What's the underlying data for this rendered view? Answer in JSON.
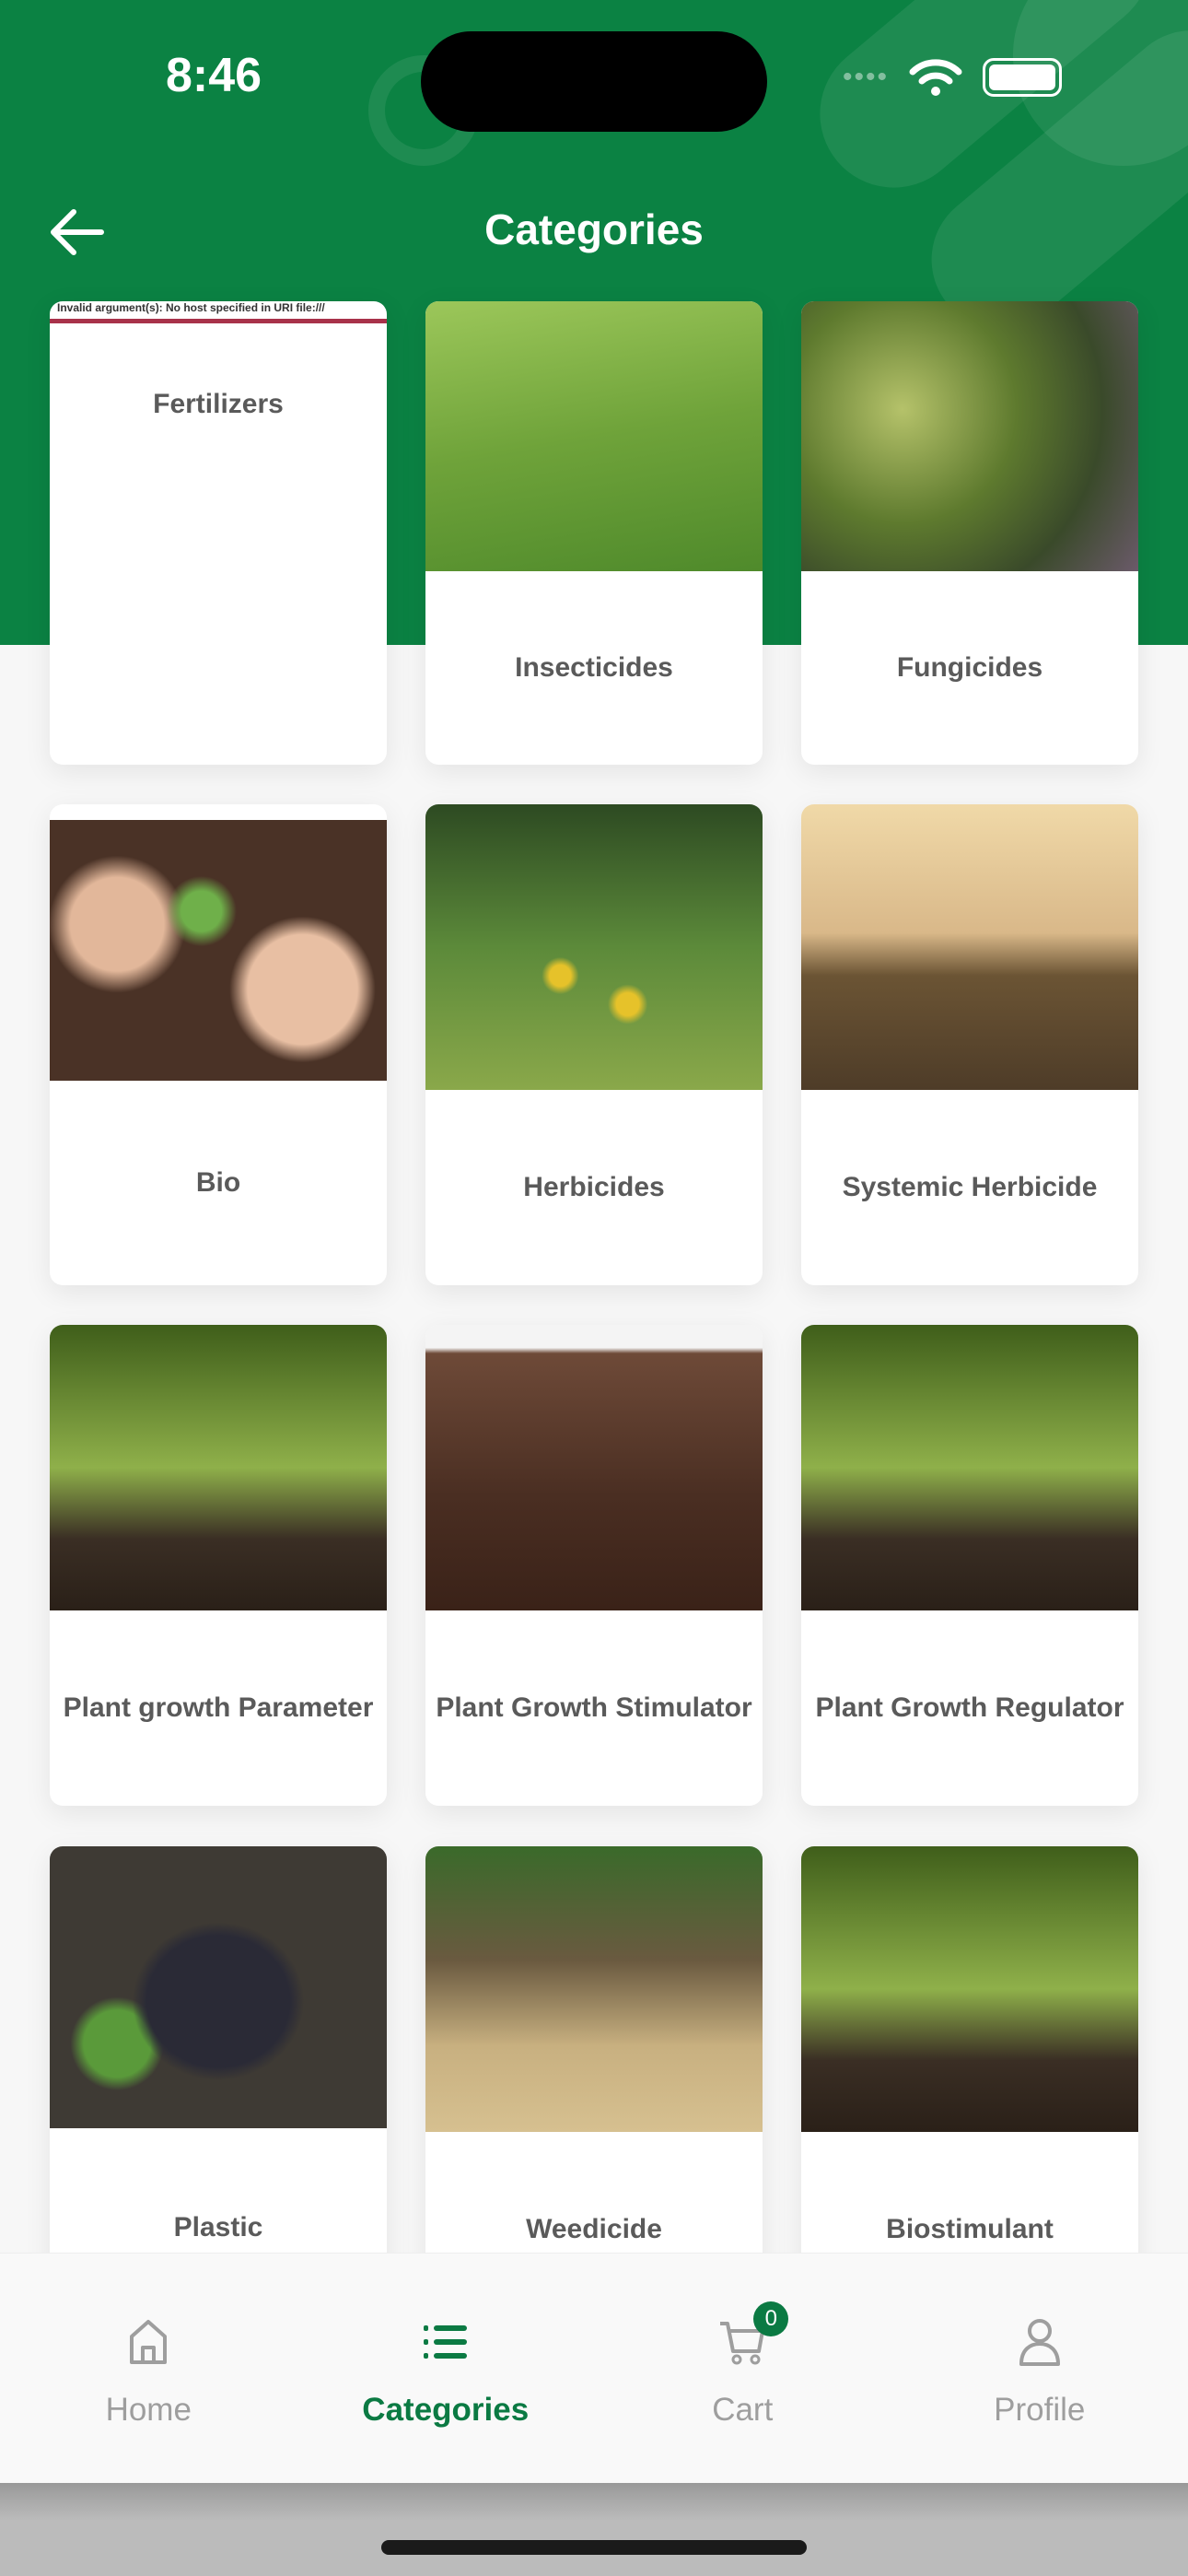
{
  "status": {
    "time": "8:46"
  },
  "header": {
    "title": "Categories",
    "back_icon": "arrow-left-icon"
  },
  "broken_image_text": "Invalid argument(s): No host specified in URI file:///",
  "categories": [
    {
      "label": "Fertilizers"
    },
    {
      "label": "Insecticides"
    },
    {
      "label": "Fungicides"
    },
    {
      "label": "Bio"
    },
    {
      "label": "Herbicides"
    },
    {
      "label": "Systemic Herbicide"
    },
    {
      "label": "Plant growth Parameter"
    },
    {
      "label": "Plant Growth Stimulator"
    },
    {
      "label": "Plant Growth Regulator"
    },
    {
      "label": "Plastic"
    },
    {
      "label": "Weedicide"
    },
    {
      "label": "Biostimulant"
    }
  ],
  "tabbar": {
    "items": [
      {
        "label": "Home",
        "icon": "home-icon"
      },
      {
        "label": "Categories",
        "icon": "list-icon"
      },
      {
        "label": "Cart",
        "icon": "cart-icon",
        "badge": "0"
      },
      {
        "label": "Profile",
        "icon": "user-icon"
      }
    ],
    "active": "Categories"
  },
  "colors": {
    "brand": "#0b8243",
    "active_tab": "#0b7a43",
    "inactive_tab": "#9e9e9e"
  }
}
